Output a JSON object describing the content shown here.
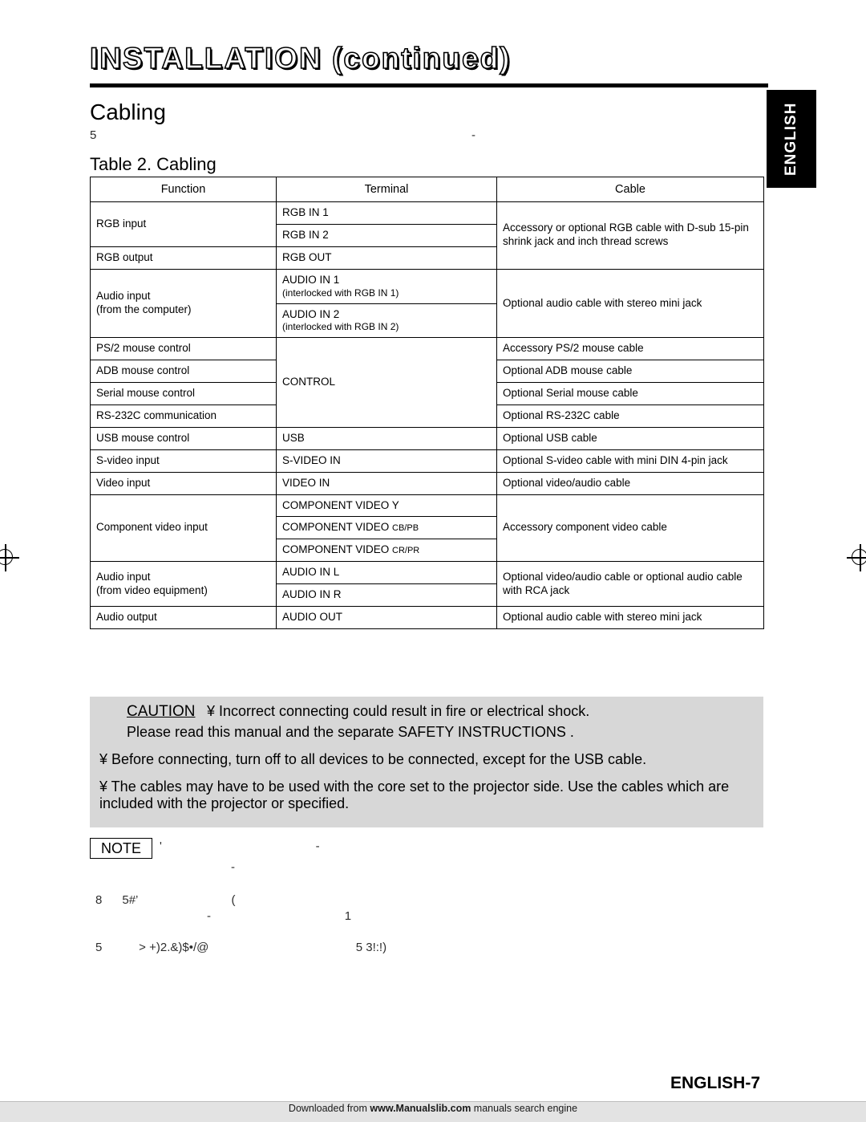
{
  "header": {
    "title": "INSTALLATION (continued)",
    "side_tab": "ENGLISH"
  },
  "section": {
    "heading": "Cabling",
    "intro_artifact_left": "5",
    "intro_artifact_right": "-",
    "table_caption": "Table 2. Cabling"
  },
  "table": {
    "columns": [
      "Function",
      "Terminal",
      "Cable"
    ],
    "rows": [
      {
        "function": "RGB input",
        "terminals": [
          "RGB IN 1",
          "RGB IN 2"
        ],
        "cable": "Accessory or optional RGB cable with D-sub 15-pin shrink jack and inch thread screws"
      },
      {
        "function": "RGB output",
        "terminals": [
          "RGB OUT"
        ],
        "cable": ""
      },
      {
        "function": "Audio input\n(from the computer)",
        "terminals": [
          "AUDIO IN 1",
          "(interlocked with RGB IN 1)",
          "AUDIO IN 2",
          "(interlocked with RGB IN 2)"
        ],
        "cable": "Optional audio cable with stereo mini jack"
      },
      {
        "function": "PS/2 mouse control",
        "terminals": [
          "CONTROL"
        ],
        "cable": "Accessory PS/2 mouse cable"
      },
      {
        "function": "ADB mouse control",
        "terminals": [],
        "cable": "Optional ADB mouse cable"
      },
      {
        "function": "Serial mouse control",
        "terminals": [],
        "cable": "Optional Serial mouse cable"
      },
      {
        "function": "RS-232C communication",
        "terminals": [],
        "cable": "Optional RS-232C cable"
      },
      {
        "function": "USB mouse control",
        "terminals": [
          "USB"
        ],
        "cable": "Optional USB cable"
      },
      {
        "function": "S-video input",
        "terminals": [
          "S-VIDEO IN"
        ],
        "cable": "Optional S-video cable with mini DIN 4-pin jack"
      },
      {
        "function": "Video input",
        "terminals": [
          "VIDEO IN"
        ],
        "cable": "Optional video/audio cable"
      },
      {
        "function": "Component video input",
        "terminals": [
          "COMPONENT VIDEO Y",
          "COMPONENT VIDEO CB/PB",
          "COMPONENT VIDEO CR/PR"
        ],
        "cable": "Accessory component video cable"
      },
      {
        "function": "Audio input\n(from video equipment)",
        "terminals": [
          "AUDIO IN L",
          "AUDIO IN R"
        ],
        "cable": "Optional video/audio cable or optional audio cable with RCA jack"
      },
      {
        "function": "Audio output",
        "terminals": [
          "AUDIO OUT"
        ],
        "cable": "Optional audio cable with stereo mini jack"
      }
    ],
    "cells": {
      "fn_rgb_input": "RGB input",
      "fn_rgb_output": "RGB output",
      "fn_audio_in_computer_1": "Audio input",
      "fn_audio_in_computer_2": "(from the computer)",
      "fn_ps2": "PS/2 mouse control",
      "fn_adb": "ADB mouse control",
      "fn_serial": "Serial mouse control",
      "fn_rs232c": "RS-232C communication",
      "fn_usb": "USB mouse control",
      "fn_svideo": "S-video input",
      "fn_video": "Video input",
      "fn_component": "Component video input",
      "fn_audio_in_video_1": "Audio input",
      "fn_audio_in_video_2": "(from video equipment)",
      "fn_audio_out": "Audio output",
      "tm_rgb_in_1": "RGB IN 1",
      "tm_rgb_in_2": "RGB IN 2",
      "tm_rgb_out": "RGB OUT",
      "tm_audio_in_1": "AUDIO IN 1",
      "tm_audio_in_1_sub": "(interlocked with RGB IN 1)",
      "tm_audio_in_2": "AUDIO IN 2",
      "tm_audio_in_2_sub": "(interlocked with RGB IN 2)",
      "tm_control": "CONTROL",
      "tm_usb": "USB",
      "tm_svideo_in": "S-VIDEO IN",
      "tm_video_in": "VIDEO IN",
      "tm_comp_y": "COMPONENT VIDEO Y",
      "tm_comp_cb_main": "COMPONENT VIDEO ",
      "tm_comp_cb_small": "CB/PB",
      "tm_comp_cr_main": "COMPONENT VIDEO ",
      "tm_comp_cr_small": "CR/PR",
      "tm_audio_in_l": "AUDIO IN L",
      "tm_audio_in_r": "AUDIO IN R",
      "tm_audio_out": "AUDIO OUT",
      "cb_rgb": "Accessory or optional RGB cable with D-sub 15-pin shrink jack and inch thread screws",
      "cb_audio_computer": "Optional audio cable with stereo mini jack",
      "cb_ps2": "Accessory PS/2 mouse cable",
      "cb_adb": "Optional ADB mouse cable",
      "cb_serial": "Optional Serial mouse cable",
      "cb_rs232c": "Optional RS-232C cable",
      "cb_usb": "Optional USB cable",
      "cb_svideo": "Optional S-video cable with mini DIN 4-pin jack",
      "cb_video": "Optional video/audio cable",
      "cb_component": "Accessory component video cable",
      "cb_audio_video": "Optional video/audio cable or optional audio cable with RCA jack",
      "cb_audio_out": "Optional audio cable with stereo mini jack"
    }
  },
  "caution": {
    "word": "CAUTION",
    "line1": "¥ Incorrect connecting could result in fire or electrical shock.",
    "line2": "Please read this manual and the separate  SAFETY INSTRUCTIONS .",
    "line3": "¥ Before connecting, turn off to all devices to be connected, except for the USB cable.",
    "line4": "¥ The cables may have to be used with the core set to the projector side. Use the cables which are included with the projector or specified."
  },
  "note": {
    "badge": "NOTE",
    "artifact1": "'                                              -",
    "artifact2": "-",
    "artifact3": "8      5#’                            (",
    "artifact4": "-                                        1",
    "artifact5": "5           > +)2.&)$•/@                                            5 3!:!)"
  },
  "footer": {
    "page_label": "ENGLISH-7",
    "download_prefix": "Downloaded from ",
    "download_link": "www.Manualslib.com",
    "download_suffix": " manuals search engine"
  }
}
